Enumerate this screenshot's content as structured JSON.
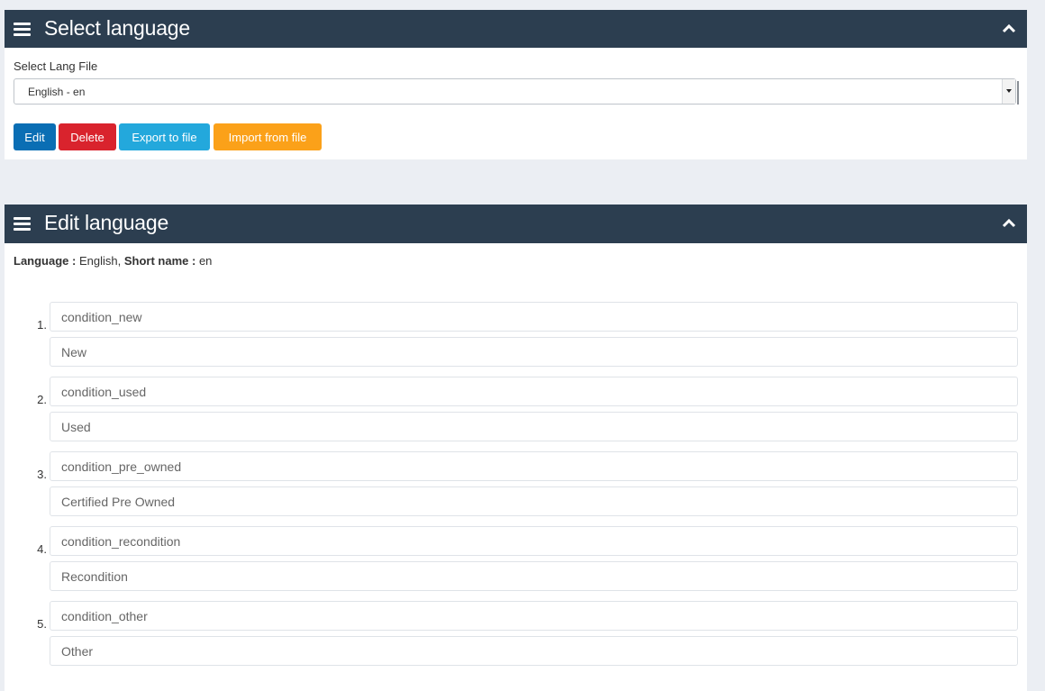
{
  "select_panel": {
    "title": "Select language",
    "field_label": "Select Lang File",
    "selected_value": "English - en",
    "buttons": {
      "edit": "Edit",
      "delete": "Delete",
      "export": "Export to file",
      "import": "Import from file"
    }
  },
  "edit_panel": {
    "title": "Edit language",
    "language_label": "Language :",
    "language_value": "English,",
    "short_name_label": "Short name :",
    "short_name_value": "en",
    "entries": [
      {
        "num": "1.",
        "key": "condition_new",
        "value": "New"
      },
      {
        "num": "2.",
        "key": "condition_used",
        "value": "Used"
      },
      {
        "num": "3.",
        "key": "condition_pre_owned",
        "value": "Certified Pre Owned"
      },
      {
        "num": "4.",
        "key": "condition_recondition",
        "value": "Recondition"
      },
      {
        "num": "5.",
        "key": "condition_other",
        "value": "Other"
      }
    ]
  },
  "colors": {
    "header_bg": "#2c3e50",
    "page_bg": "#ebeef3",
    "edit_btn": "#0a6eb4",
    "delete_btn": "#d9232d",
    "export_btn": "#23a8dc",
    "import_btn": "#fba119"
  },
  "icons": {
    "menu": "hamburger-icon",
    "collapse": "chevron-up-icon",
    "dropdown": "caret-down-icon"
  }
}
